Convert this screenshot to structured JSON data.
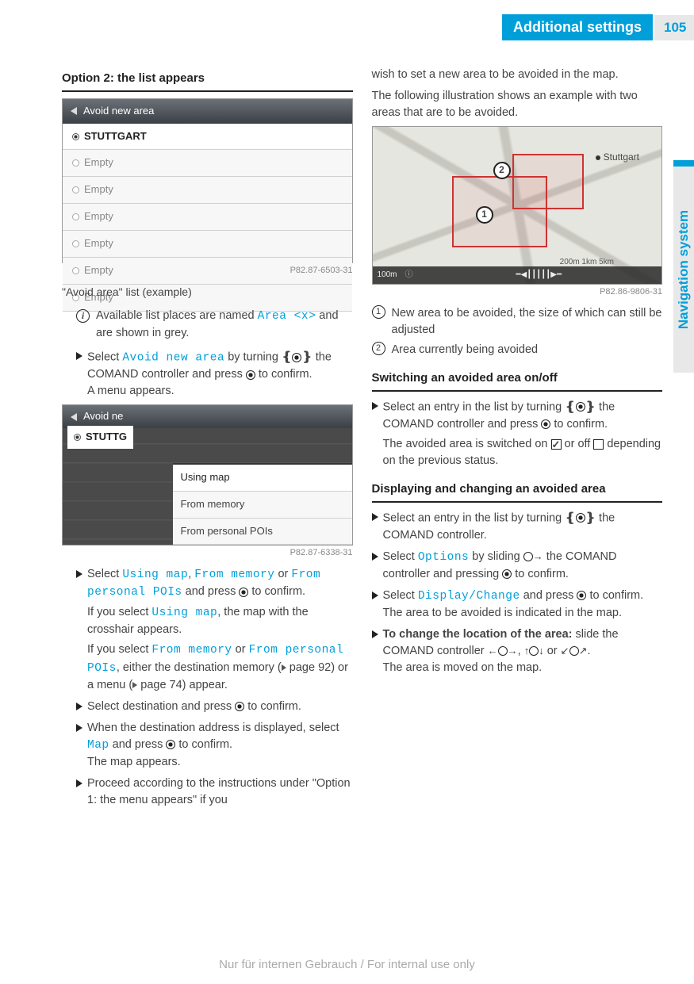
{
  "header": {
    "title": "Additional settings",
    "page": "105",
    "side_tab": "Navigation system"
  },
  "left": {
    "h1": "Option 2: the list appears",
    "shot1": {
      "header": "Avoid new area",
      "selected": "STUTTGART",
      "rows": [
        "Empty",
        "Empty",
        "Empty",
        "Empty",
        "Empty",
        "Empty"
      ],
      "cap": "P82.87-6503-31"
    },
    "caption1": "\"Avoid area\" list (example)",
    "info1_a": "Available list places are named ",
    "info1_mono": "Area <x>",
    "info1_b": " and are shown in grey.",
    "step1_a": "Select ",
    "step1_mono": "Avoid new area",
    "step1_b": " by turning ",
    "step1_c": " the COMAND controller and press ",
    "step1_d": " to confirm.",
    "step1_sub": "A menu appears.",
    "shot2": {
      "header": "Avoid ne",
      "selected": "STUTTG",
      "menu": [
        "Using map",
        "From memory",
        "From personal POIs"
      ],
      "cap": "P82.87-6338-31"
    },
    "step2_a": "Select ",
    "step2_m1": "Using map",
    "step2_s1": ", ",
    "step2_m2": "From memory",
    "step2_s2": " or ",
    "step2_m3": "From personal POIs",
    "step2_b": " and press ",
    "step2_c": " to confirm.",
    "step2_sub1_a": "If you select ",
    "step2_sub1_m": "Using map",
    "step2_sub1_b": ", the map with the crosshair appears.",
    "step2_sub2_a": "If you select ",
    "step2_sub2_m1": "From memory",
    "step2_sub2_s": " or ",
    "step2_sub2_m2": "From per­sonal POIs",
    "step2_sub2_b": ", either the destination mem­ory (",
    "step2_sub2_pg1": " page 92) or a menu (",
    "step2_sub2_pg2": " page 74) appear.",
    "step3": "Select destination and press ",
    "step3_b": " to confirm.",
    "step4_a": "When the destination address is displayed, select ",
    "step4_m": "Map",
    "step4_b": " and press ",
    "step4_c": " to confirm.",
    "step4_sub": "The map appears.",
    "step5": "Proceed according to the instructions under \"Option 1: the menu appears\" if you"
  },
  "right": {
    "cont1": "wish to set a new area to be avoided in the map.",
    "cont2": "The following illustration shows an example with two areas that are to be avoided.",
    "shot3": {
      "city": "Stuttgart",
      "scale_left": "100m",
      "scale_mid": "200m   1km   5km",
      "cap": "P82.86-9806-31"
    },
    "legend1": "New area to be avoided, the size of which can still be adjusted",
    "legend2": "Area currently being avoided",
    "h2": "Switching an avoided area on/off",
    "s1_a": "Select an entry in the list by turning ",
    "s1_b": " the COMAND controller and press ",
    "s1_c": " to confirm.",
    "s1_sub_a": "The avoided area is switched on ",
    "s1_sub_b": " or off ",
    "s1_sub_c": " depending on the previous status.",
    "h3": "Displaying and changing an avoided area",
    "s2_a": "Select an entry in the list by turning ",
    "s2_b": " the COMAND controller.",
    "s3_a": "Select ",
    "s3_m": "Options",
    "s3_b": " by sliding ",
    "s3_c": " the COMAND controller and pressing ",
    "s3_d": " to confirm.",
    "s4_a": "Select ",
    "s4_m": "Display/Change",
    "s4_b": " and press ",
    "s4_c": " to confirm.",
    "s4_sub": "The area to be avoided is indicated in the map.",
    "s5_bold": "To change the location of the area:",
    "s5_a": " slide the COMAND controller ",
    "s5_b": ", ",
    "s5_c": " or ",
    "s5_d": ".",
    "s5_sub": "The area is moved on the map."
  },
  "footer": "Nur für internen Gebrauch / For internal use only"
}
